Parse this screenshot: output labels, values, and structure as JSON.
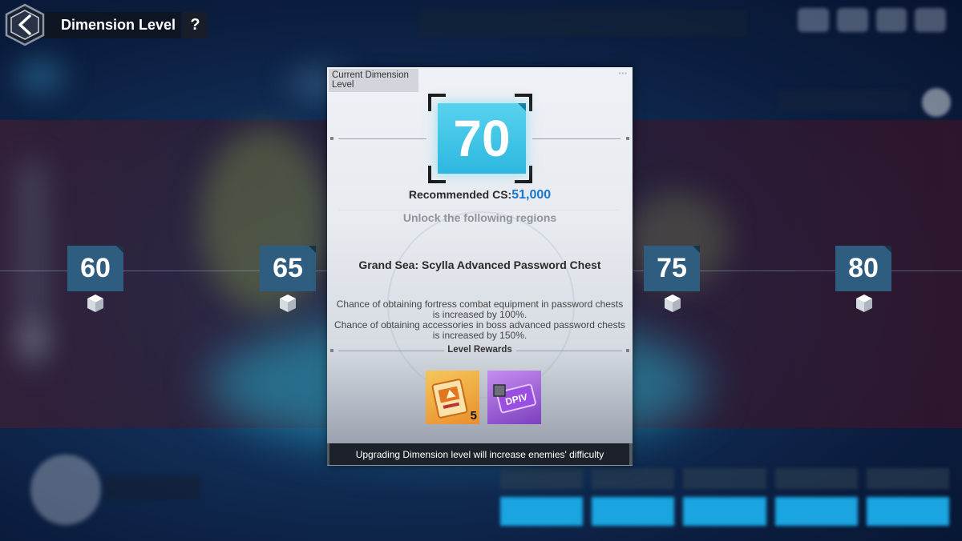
{
  "header": {
    "title": "Dimension Level",
    "help_label": "?"
  },
  "levels": [
    {
      "value": "60"
    },
    {
      "value": "65"
    },
    {
      "value": "75"
    },
    {
      "value": "80"
    }
  ],
  "panel": {
    "current_label": "Current Dimension Level",
    "current_level": "70",
    "recommended_cs_label": "Recommended CS:",
    "recommended_cs_value": "51,000",
    "unlock_text": "Unlock the following regions",
    "region_name": "Grand Sea: Scylla Advanced Password Chest",
    "description_lines": [
      "Chance of obtaining fortress combat equipment in password chests",
      "is increased by 100%.",
      "Chance of obtaining accessories in boss advanced password chests",
      "is increased by 150%."
    ],
    "rewards_title": "Level Rewards",
    "rewards": [
      {
        "icon": "orange-voucher-icon",
        "quantity": "5"
      },
      {
        "icon": "purple-dpiv-chip-icon",
        "label": "DPIV"
      }
    ],
    "warning": "Upgrading Dimension level will increase enemies' difficulty"
  },
  "colors": {
    "level_tile": "#2f5d80",
    "current_tile": "#3cc2e6",
    "cs_value": "#1676d2",
    "warning_bar": "#1d222a"
  }
}
